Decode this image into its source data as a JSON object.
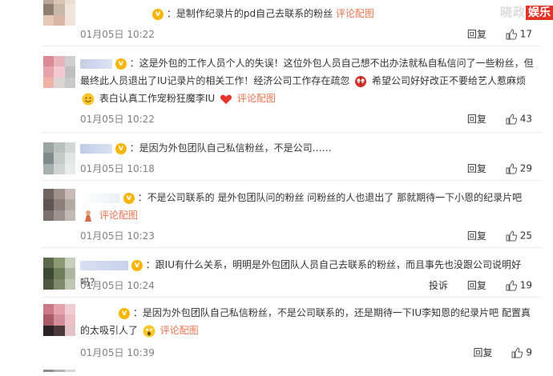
{
  "watermark": {
    "left": "晓政",
    "right": "娱乐"
  },
  "comments": [
    {
      "text": "：是制作纪录片的pd自己去联系的粉丝",
      "link": "评论配图",
      "time": "01月05日 10:22",
      "reply": "回复",
      "likes": "17"
    },
    {
      "text_a": "：这是外包的工作人员个人的失误！这位外包人员自己想不出办法就私自私信问了一些粉丝，但最终此人员退出了IU记录片的相关工作！经济公司工作存在疏忽",
      "text_b": "希望公司好好改正不要给艺人惹麻烦",
      "text_c": "表白认真工作宠粉狂魔李IU",
      "link": "评论配图",
      "time": "01月05日 10:22",
      "reply": "回复",
      "likes": "43"
    },
    {
      "text": "：是因为外包团队自己私信粉丝，不是公司……",
      "time": "01月05日 10:18",
      "reply": "回复",
      "likes": "29"
    },
    {
      "text": "：不是公司联系的 是外包团队问的粉丝 问粉丝的人也退出了 那就期待一下小恩的纪录片吧",
      "link": "评论配图",
      "time": "01月05日 10:23",
      "reply": "回复",
      "likes": "25"
    },
    {
      "text": "：跟IU有什么关系，明明是外包团队人员自己去联系的粉丝，而且事先也没跟公司说明好吗？",
      "time": "01月05日 10:24",
      "report": "投诉",
      "reply": "回复",
      "likes": "19"
    },
    {
      "text_a": "：是因为外包团队自己私信粉丝，不是公司联系的，还是期待一下IU李知恩的纪录片吧 配置真的太吸引人了",
      "link": "评论配图",
      "time": "01月05日 10:39",
      "reply": "回复",
      "likes": "9"
    }
  ],
  "colors": {
    "link": "#eb7350",
    "meta": "#808080",
    "verified": "#f7b500"
  }
}
